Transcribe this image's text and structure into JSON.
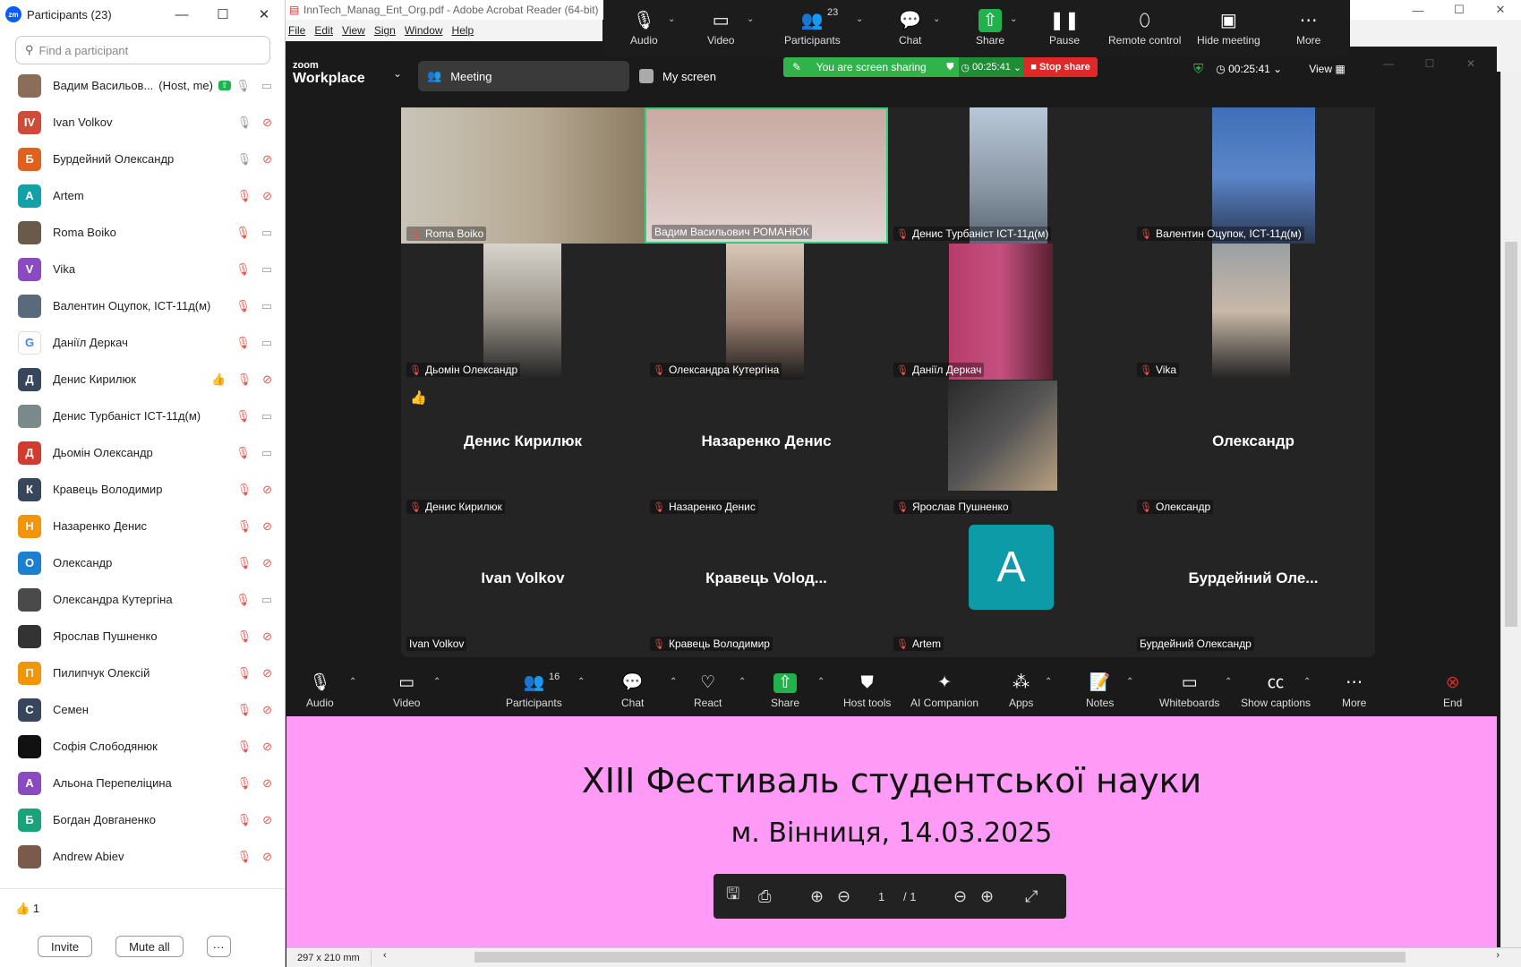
{
  "participants_panel": {
    "title": "Participants (23)",
    "search_placeholder": "Find a participant",
    "items": [
      {
        "name": "Вадим Васильов...",
        "suffix": "(Host, me)",
        "initial": "",
        "color": "#8b6e5a"
      },
      {
        "name": "Ivan Volkov",
        "initial": "IV",
        "color": "#d04a3a"
      },
      {
        "name": "Бурдейний Олександр",
        "initial": "Б",
        "color": "#e0601f"
      },
      {
        "name": "Artem",
        "initial": "A",
        "color": "#13a0a8"
      },
      {
        "name": "Roma Boiko",
        "initial": "",
        "color": "#6a5a4a"
      },
      {
        "name": "Vika",
        "initial": "V",
        "color": "#8a4ac0"
      },
      {
        "name": "Валентин Оцупок, ICT-11д(м)",
        "initial": "",
        "color": "#5a6a7a"
      },
      {
        "name": "Даніїл Деркач",
        "initial": "G",
        "color": "#ffffff"
      },
      {
        "name": "Денис Кирилюк",
        "initial": "Д",
        "color": "#37465a"
      },
      {
        "name": "Денис Турбаніст ICT-11д(м)",
        "initial": "",
        "color": "#7a8a8a"
      },
      {
        "name": "Дьомін Олександр",
        "initial": "Д",
        "color": "#d23b2f"
      },
      {
        "name": "Кравець Володимир",
        "initial": "К",
        "color": "#37465a"
      },
      {
        "name": "Назаренко Денис",
        "initial": "Н",
        "color": "#f0950c"
      },
      {
        "name": "Олександр",
        "initial": "О",
        "color": "#1d7fd0"
      },
      {
        "name": "Олександра Кутергіна",
        "initial": "",
        "color": "#4a4a4a"
      },
      {
        "name": "Ярослав Пушненко",
        "initial": "",
        "color": "#333333"
      },
      {
        "name": "Пилипчук Олексій",
        "initial": "П",
        "color": "#f0950c"
      },
      {
        "name": "Семен",
        "initial": "С",
        "color": "#37465a"
      },
      {
        "name": "Софія Слободянюк",
        "initial": "",
        "color": "#111111"
      },
      {
        "name": "Альона Перепеліцина",
        "initial": "А",
        "color": "#8a4ac0"
      },
      {
        "name": "Богдан Довганенко",
        "initial": "Б",
        "color": "#1aa37a"
      },
      {
        "name": "Andrew Abiev",
        "initial": "",
        "color": "#7a5a4a"
      }
    ],
    "reaction_count": "1",
    "invite_label": "Invite",
    "mute_all_label": "Mute all",
    "more_label": "···"
  },
  "acrobat": {
    "title": "InnTech_Manag_Ent_Org.pdf - Adobe Acrobat Reader (64-bit)",
    "menu": [
      "File",
      "Edit",
      "View",
      "Sign",
      "Window",
      "Help"
    ],
    "page_line1": "XIII Фестиваль студентської науки",
    "page_line2": "м. Вінниця, 14.03.2025",
    "page_current": "1",
    "page_total": "/ 1",
    "page_size": "297 x 210 mm"
  },
  "share_bar": {
    "items": [
      {
        "label": "Audio"
      },
      {
        "label": "Video"
      },
      {
        "label": "Participants",
        "count": "23"
      },
      {
        "label": "Chat"
      },
      {
        "label": "Share"
      },
      {
        "label": "Pause"
      },
      {
        "label": "Remote control"
      },
      {
        "label": "Hide meeting"
      },
      {
        "label": "More"
      }
    ]
  },
  "zoom": {
    "logo_small": "zoom",
    "logo_big": "Workplace",
    "tab_meeting": "Meeting",
    "tab_myscreen": "My screen",
    "sharing_text": "You are screen sharing",
    "sharing_timer": "00:25:41",
    "stop_share": "Stop share",
    "meeting_timer": "00:25:41",
    "view_label": "View",
    "tiles": [
      {
        "name": "Roma Boiko"
      },
      {
        "name": "Вадим Васильович РОМАНЮК"
      },
      {
        "name": "Денис Турбаніст ICT-11д(м)"
      },
      {
        "name": "Валентин Оцупок, ICT-11д(м)"
      },
      {
        "name": "Дьомін Олександр"
      },
      {
        "name": "Олександра Кутергіна"
      },
      {
        "name": "Даніїл Деркач"
      },
      {
        "name": "Vika"
      },
      {
        "name": "Денис Кирилюк",
        "big": "Денис Кирилюк"
      },
      {
        "name": "Назаренко Денис",
        "big": "Назаренко Денис"
      },
      {
        "name": "Ярослав Пушненко"
      },
      {
        "name": "Олександр",
        "big": "Олександр"
      },
      {
        "name": "Ivan Volkov",
        "big": "Ivan Volkov"
      },
      {
        "name": "Кравець Володимир",
        "big": "Кравець Volод..."
      },
      {
        "name": "Artem",
        "avatar": "A"
      },
      {
        "name": "Бурдейний Олександр",
        "big": "Бурдейний Оле..."
      }
    ],
    "toolbar": [
      {
        "label": "Audio"
      },
      {
        "label": "Video"
      },
      {
        "label": "Participants",
        "count": "16"
      },
      {
        "label": "Chat"
      },
      {
        "label": "React"
      },
      {
        "label": "Share"
      },
      {
        "label": "Host tools"
      },
      {
        "label": "AI Companion"
      },
      {
        "label": "Apps"
      },
      {
        "label": "Notes"
      },
      {
        "label": "Whiteboards"
      },
      {
        "label": "Show captions"
      },
      {
        "label": "More"
      },
      {
        "label": "End"
      }
    ]
  }
}
